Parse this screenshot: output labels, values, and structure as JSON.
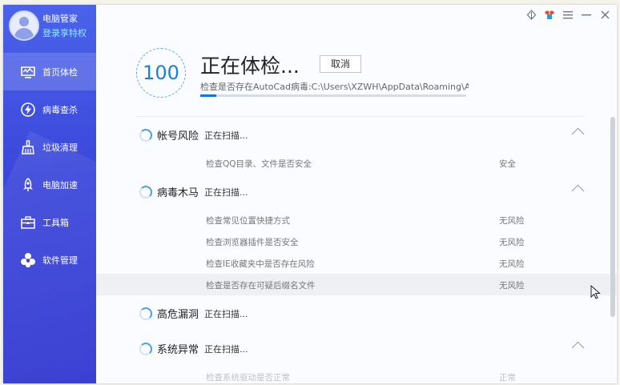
{
  "user": {
    "name": "电脑管家",
    "login": "登录享特权"
  },
  "nav": [
    {
      "label": "首页体检",
      "icon": "monitor-icon",
      "active": true
    },
    {
      "label": "病毒查杀",
      "icon": "lightning-shield-icon",
      "active": false
    },
    {
      "label": "垃圾清理",
      "icon": "broom-icon",
      "active": false
    },
    {
      "label": "电脑加速",
      "icon": "rocket-icon",
      "active": false
    },
    {
      "label": "工具箱",
      "icon": "toolbox-icon",
      "active": false
    },
    {
      "label": "软件管理",
      "icon": "software-icon",
      "active": false
    }
  ],
  "top_icons": [
    "leaf-icon",
    "shirt-icon",
    "menu-icon",
    "minimize-icon",
    "close-icon"
  ],
  "scan": {
    "score": "100",
    "title": "正在体检...",
    "cancel": "取消",
    "path": "检查是否存在AutoCad病毒:C:\\Users\\XZWH\\AppData\\Roaming\\Au...",
    "progress": 0.06
  },
  "groups": [
    {
      "title": "帐号风险",
      "status": "正在扫描...",
      "expanded": true,
      "items": [
        {
          "label": "检查QQ目录、文件是否安全",
          "result": "安全"
        }
      ]
    },
    {
      "title": "病毒木马",
      "status": "正在扫描...",
      "expanded": true,
      "items": [
        {
          "label": "检查常见位置快捷方式",
          "result": "无风险"
        },
        {
          "label": "检查浏览器插件是否安全",
          "result": "无风险"
        },
        {
          "label": "检查IE收藏夹中是否存在风险",
          "result": "无风险"
        },
        {
          "label": "检查是否存在可疑后缀名文件",
          "result": "无风险"
        }
      ]
    },
    {
      "title": "高危漏洞",
      "status": "正在扫描...",
      "expanded": false,
      "items": []
    },
    {
      "title": "系统异常",
      "status": "正在扫描...",
      "expanded": true,
      "items": [
        {
          "label": "检查系统驱动是否正常",
          "result": "正常"
        }
      ]
    }
  ]
}
